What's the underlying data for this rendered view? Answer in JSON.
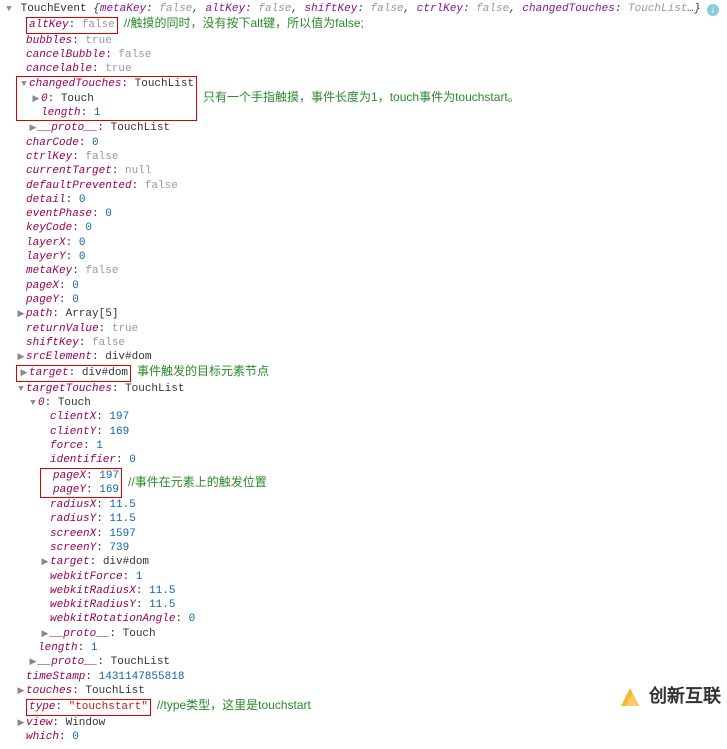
{
  "header": {
    "typeName": "TouchEvent",
    "summary": "{metaKey: false, altKey: false, shiftKey: false, ctrlKey: false, changedTouches: TouchList…}"
  },
  "props": {
    "altKey_label": "altKey",
    "altKey_val": "false",
    "altKey_annotation": "//触摸的同时，没有按下alt键，所以值为false;",
    "bubbles_label": "bubbles",
    "bubbles_val": "true",
    "cancelBubble_label": "cancelBubble",
    "cancelBubble_val": "false",
    "cancelable_label": "cancelable",
    "cancelable_val": "true",
    "changedTouches_label": "changedTouches",
    "changedTouches_val": "TouchList",
    "changedTouches_annotation": "只有一个手指触摸，事件长度为1，touch事件为touchstart。",
    "ct_0_label": "0",
    "ct_0_val": "Touch",
    "ct_length_label": "length",
    "ct_length_val": "1",
    "ct_proto_label": "__proto__",
    "ct_proto_val": "TouchList",
    "charCode_label": "charCode",
    "charCode_val": "0",
    "ctrlKey_label": "ctrlKey",
    "ctrlKey_val": "false",
    "currentTarget_label": "currentTarget",
    "currentTarget_val": "null",
    "defaultPrevented_label": "defaultPrevented",
    "defaultPrevented_val": "false",
    "detail_label": "detail",
    "detail_val": "0",
    "eventPhase_label": "eventPhase",
    "eventPhase_val": "0",
    "keyCode_label": "keyCode",
    "keyCode_val": "0",
    "layerX_label": "layerX",
    "layerX_val": "0",
    "layerY_label": "layerY",
    "layerY_val": "0",
    "metaKey_label": "metaKey",
    "metaKey_val": "false",
    "pageX_label": "pageX",
    "pageX_val": "0",
    "pageY_label": "pageY",
    "pageY_val": "0",
    "path_label": "path",
    "path_val": "Array[5]",
    "returnValue_label": "returnValue",
    "returnValue_val": "true",
    "shiftKey_label": "shiftKey",
    "shiftKey_val": "false",
    "srcElement_label": "srcElement",
    "srcElement_val": "div#dom",
    "target_label": "target",
    "target_val": "div#dom",
    "target_annotation": "事件触发的目标元素节点",
    "targetTouches_label": "targetTouches",
    "targetTouches_val": "TouchList",
    "tt_0_label": "0",
    "tt_0_val": "Touch",
    "tt_clientX_label": "clientX",
    "tt_clientX_val": "197",
    "tt_clientY_label": "clientY",
    "tt_clientY_val": "169",
    "tt_force_label": "force",
    "tt_force_val": "1",
    "tt_identifier_label": "identifier",
    "tt_identifier_val": "0",
    "tt_pageX_label": "pageX",
    "tt_pageX_val": "197",
    "tt_pageY_label": "pageY",
    "tt_pageY_val": "169",
    "tt_pageXY_annotation": "//事件在元素上的触发位置",
    "tt_radiusX_label": "radiusX",
    "tt_radiusX_val": "11.5",
    "tt_radiusY_label": "radiusY",
    "tt_radiusY_val": "11.5",
    "tt_screenX_label": "screenX",
    "tt_screenX_val": "1597",
    "tt_screenY_label": "screenY",
    "tt_screenY_val": "739",
    "tt_target_label": "target",
    "tt_target_val": "div#dom",
    "tt_webkitForce_label": "webkitForce",
    "tt_webkitForce_val": "1",
    "tt_webkitRadiusX_label": "webkitRadiusX",
    "tt_webkitRadiusX_val": "11.5",
    "tt_webkitRadiusY_label": "webkitRadiusY",
    "tt_webkitRadiusY_val": "11.5",
    "tt_webkitRotationAngle_label": "webkitRotationAngle",
    "tt_webkitRotationAngle_val": "0",
    "tt_proto_label": "__proto__",
    "tt_proto_val": "Touch",
    "tt_length_label": "length",
    "tt_length_val": "1",
    "tt_proto2_label": "__proto__",
    "tt_proto2_val": "TouchList",
    "timeStamp_label": "timeStamp",
    "timeStamp_val": "1431147855818",
    "touches_label": "touches",
    "touches_val": "TouchList",
    "type_label": "type",
    "type_val": "\"touchstart\"",
    "type_annotation": "//type类型，这里是touchstart",
    "view_label": "view",
    "view_val": "Window",
    "which_label": "which",
    "which_val": "0"
  },
  "watermark": {
    "text": "创新互联"
  }
}
